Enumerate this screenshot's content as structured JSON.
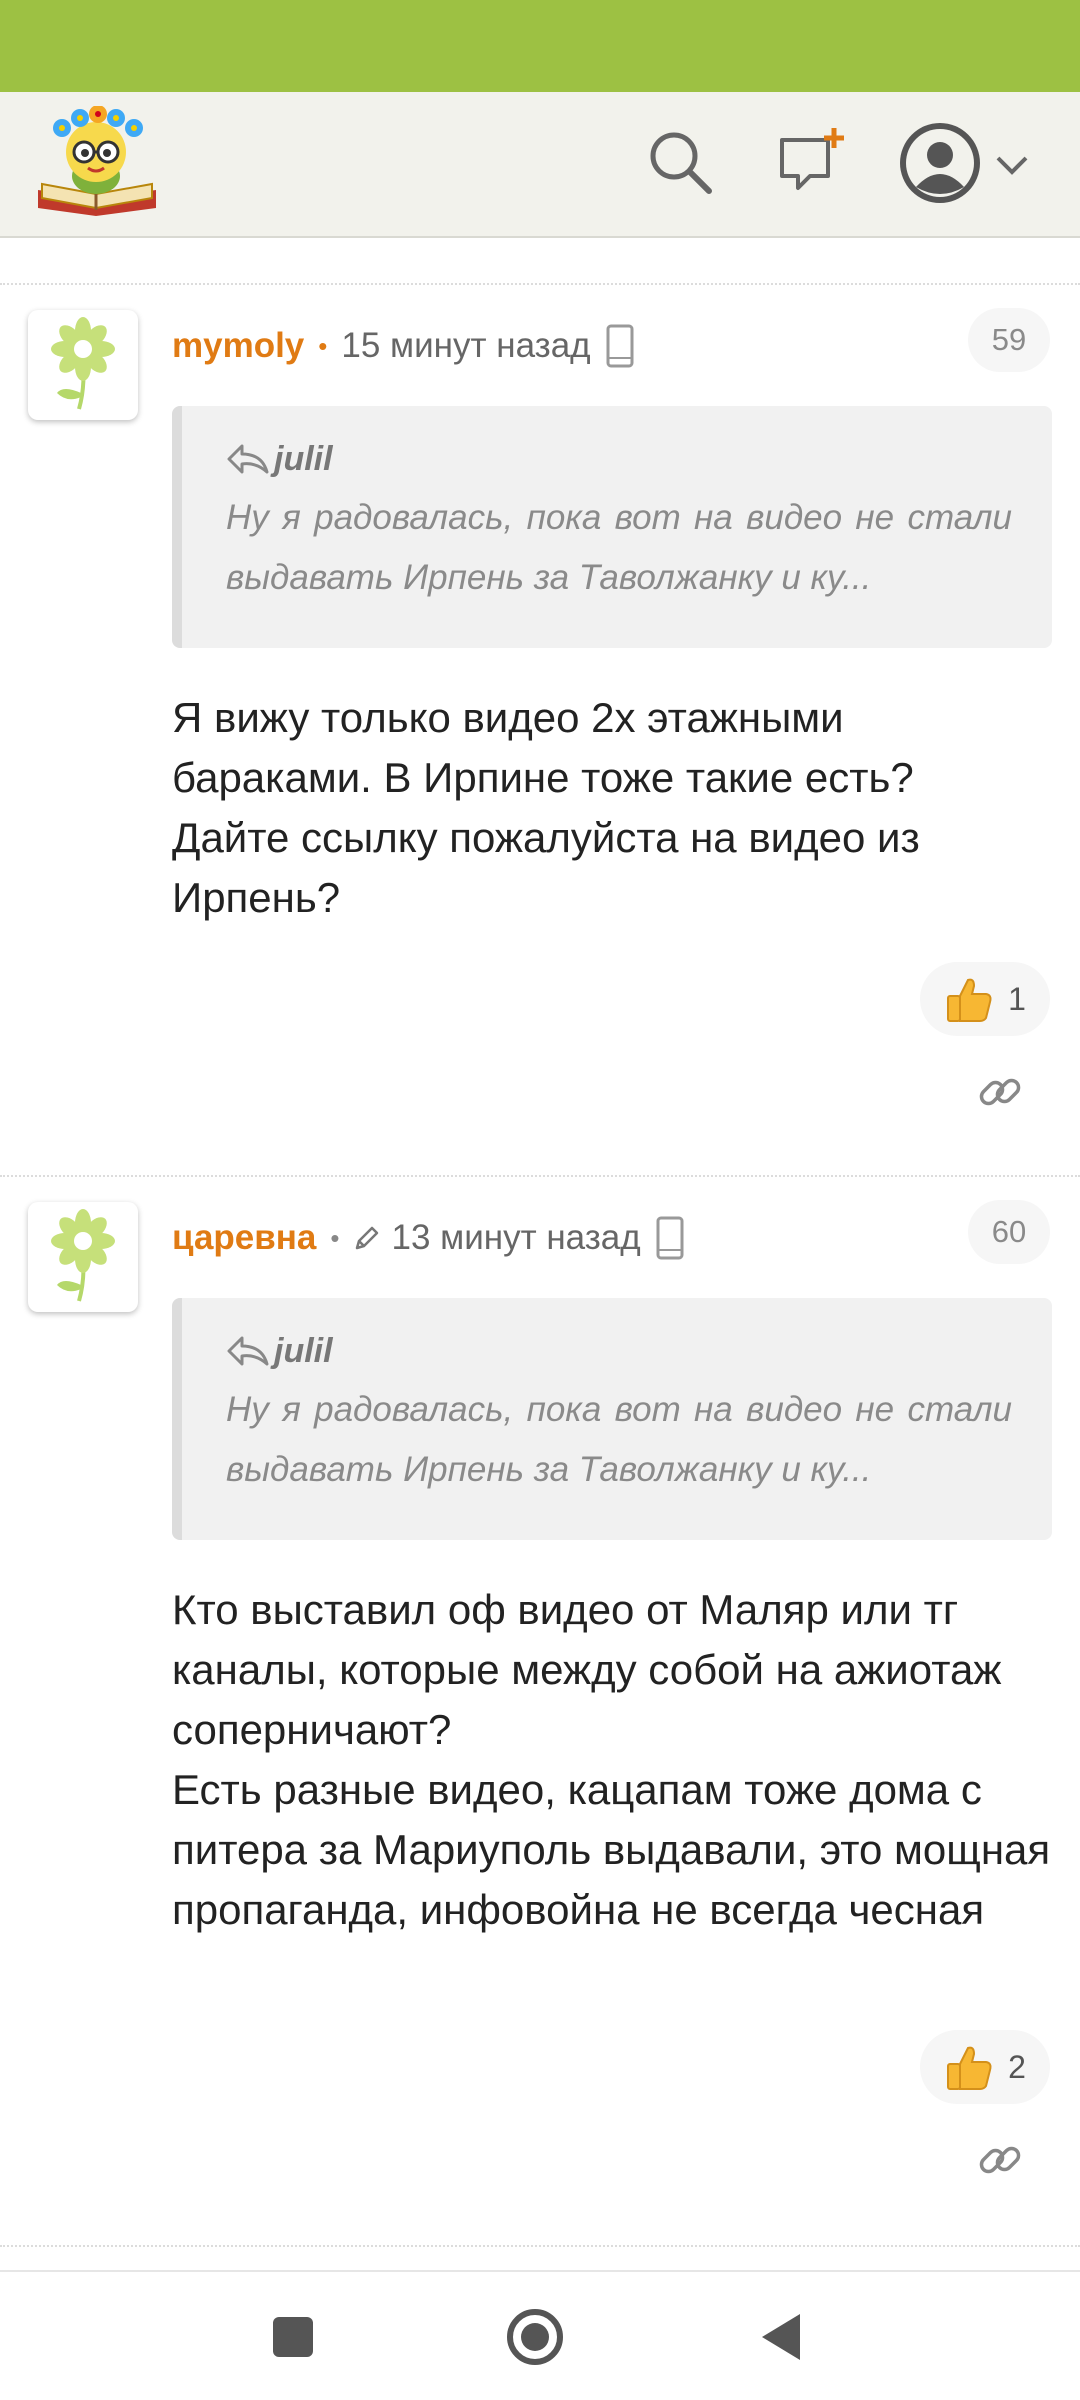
{
  "app": {
    "colors": {
      "status_bar": "#9dc143",
      "accent": "#e07b14",
      "header_bg": "#f2f2ec"
    },
    "header_icons": [
      "logo-icon",
      "search-icon",
      "compose-icon",
      "profile-icon",
      "chevron-down-icon"
    ]
  },
  "comments": [
    {
      "author": "mymoly",
      "separator": "•",
      "time": "15 минут назад",
      "number": "59",
      "quote_user": "julil",
      "quote_text": "Ну я радовалась, пока вот на видео не стали выдавать Ирпень за Таволжанку и ку...",
      "body": "Я вижу только видео 2х этажными бараками. В Ирпине тоже такие есть?\nДайте ссылку пожалуйста на видео из Ирпень?",
      "likes": "1"
    },
    {
      "author": "царевна",
      "separator": "•",
      "time": "13 минут назад",
      "number": "60",
      "quote_user": "julil",
      "quote_text": "Ну я радовалась, пока вот на видео не стали выдавать Ирпень за Таволжанку и ку...",
      "body": "Кто выставил оф видео от Маляр или тг каналы, которые между собой на ажиотаж соперничают?\nЕсть разные видео, кацапам тоже дома с питера за Мариуполь выдавали, это мощная пропаганда, инфовойна не всегда чесная",
      "likes": "2"
    }
  ],
  "nav": {
    "buttons": [
      "recents-icon",
      "home-icon",
      "back-icon"
    ]
  }
}
